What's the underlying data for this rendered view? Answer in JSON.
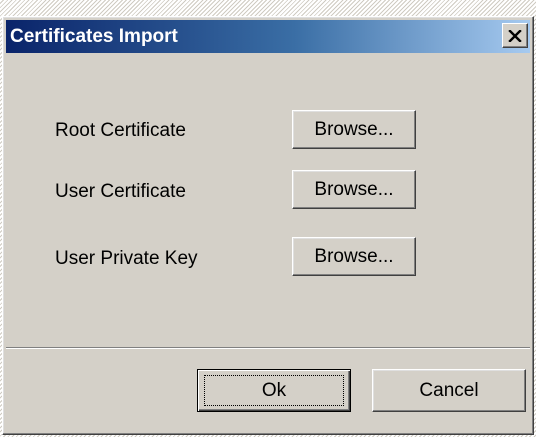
{
  "dialog": {
    "title": "Certificates Import",
    "close_icon": "close-icon"
  },
  "rows": [
    {
      "label": "Root Certificate",
      "button_label": "Browse..."
    },
    {
      "label": "User Certificate",
      "button_label": "Browse..."
    },
    {
      "label": "User Private Key",
      "button_label": "Browse..."
    }
  ],
  "footer": {
    "ok_label": "Ok",
    "cancel_label": "Cancel"
  },
  "colors": {
    "face": "#d4d0c8",
    "title_start": "#0a246a",
    "title_end": "#a6caf0"
  }
}
